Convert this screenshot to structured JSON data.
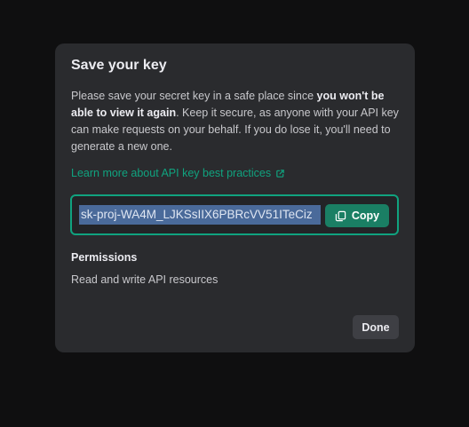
{
  "modal": {
    "title": "Save your key",
    "description": {
      "part1": "Please save your secret key in a safe place since ",
      "bold": "you won't be able to view it again",
      "part2": ". Keep it secure, as anyone with your API key can make requests on your behalf. If you do lose it, you'll need to generate a new one."
    },
    "learn_link": {
      "label": "Learn more about API key best practices",
      "icon": "external-link-icon"
    },
    "key": {
      "value": "sk-proj-WA4M_LJKSsIIX6PBRcVV51ITeCiz",
      "copy_label": "Copy",
      "copy_icon": "copy-icon"
    },
    "permissions": {
      "heading": "Permissions",
      "value": "Read and write API resources"
    },
    "done_label": "Done"
  },
  "colors": {
    "accent": "#10a37f",
    "copy_button": "#1a7f64",
    "background": "#0f0f10",
    "modal": "#2a2b2e"
  }
}
